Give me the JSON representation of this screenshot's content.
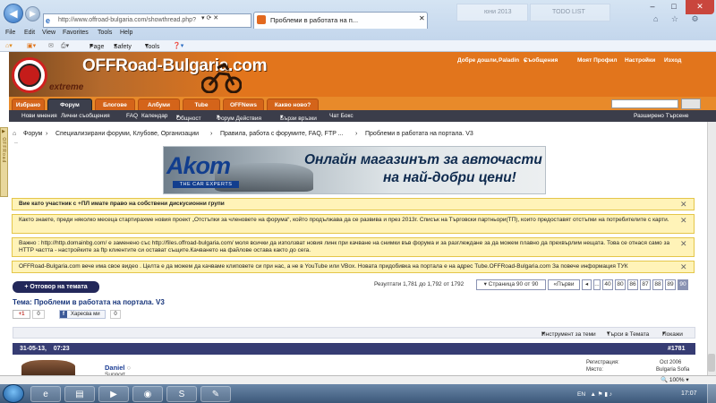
{
  "browser": {
    "url": "http://www.offroad-bulgaria.com/showthread.php?",
    "active_tab": "Проблеми в работата на п...",
    "bg_tab1": "юни 2013",
    "bg_tab2": "TODO LIST",
    "menu": [
      "File",
      "Edit",
      "View",
      "Favorites",
      "Tools",
      "Help"
    ],
    "commands": [
      "Page",
      "Safety",
      "Tools"
    ],
    "zoom": "100%"
  },
  "site": {
    "logo": "OFFRoad-Bulgaria.com",
    "logo_sub": "extreme",
    "user_links": [
      "Добре дошли,",
      "Paladin",
      "Съобщения",
      "Моят Профил",
      "Настройки",
      "Изход"
    ],
    "nav_tabs": [
      "Избрано",
      "Форум",
      "Блогове",
      "Албуми",
      "Tube",
      "OFFNews",
      "Какво ново?"
    ],
    "selected_tab": "Форум",
    "subnav": [
      "Нови мнения",
      "Лични съобщения",
      "FAQ",
      "Календар",
      "Общност",
      "Форум Действия",
      "Бързи връзки",
      "Чат Бокс"
    ],
    "advanced_search": "Разширено Търсене"
  },
  "breadcrumb": [
    "Форум",
    "Специализирани форуми, Клубове, Организации",
    "Правила, работа с форумите, FAQ, FTP ...",
    "Проблеми в работата на портала. V3"
  ],
  "banner": {
    "brand": "Akom",
    "tagline": "THE CAR EXPERTS",
    "line1": "Онлайн магазинът за авточасти",
    "line2": "на най-добри цени!"
  },
  "notices": [
    "Вие като участник с +ПЛ имате право на собствени дискусионни групи",
    "Както знаете, преди няколко месеца стартирахме новия проект „Отстъпки за членовете на форума“, който продължава да се развива и през 2013г. Списък на Търговски партньори(ТП), които предоставят отстъпки на потребителите с карти.",
    "Важно : http://http.domainbg.com/ е заменено със http://files.offroad-bulgaria.com/ моля всички да използват новия линк при качване на снимки във форума и за разглеждане за да можем плавно да прехвърлим нещата. Това се отнася само за HTTP частта - настройките за ftp клиентите си остават същите.Качването на файлове остава както до сега.",
    "OFFRoad-Bulgaria.com вече има свое видео . Целта е да можем да качваме клиповете си при нас, а не в YouTube или VBox. Новата придобивка на портала е на адрес Tube.OFFRoad-Bulgaria.com За повече информация ТУК"
  ],
  "thread": {
    "reply_button": "+ Отговор на темата",
    "results": "Резултати 1,781 до 1,792 от 1792",
    "page_of": "Страница 90 от 90",
    "first": "«Първи",
    "pages": [
      "40",
      "80",
      "86",
      "87",
      "88",
      "89",
      "90"
    ],
    "current_page": "90",
    "title": "Тема: Проблеми в работата на портала. V3",
    "gplus": "+1",
    "gplus_count": "0",
    "fb_like": "Харесва ми",
    "fb_count": "0",
    "tools": "Инструмент за теми",
    "search": "Търси в Темата",
    "display": "Покажи"
  },
  "post": {
    "date": "31-05-13,",
    "time": "07:23",
    "number": "#1781",
    "author": "Daniel",
    "role": "Support",
    "stats": [
      {
        "label": "Регистрация:",
        "value": "Oct 2006"
      },
      {
        "label": "Място:",
        "value": "Bulgaria Sofia"
      }
    ]
  },
  "taskbar": {
    "lang": "EN",
    "clock": "17:07"
  }
}
